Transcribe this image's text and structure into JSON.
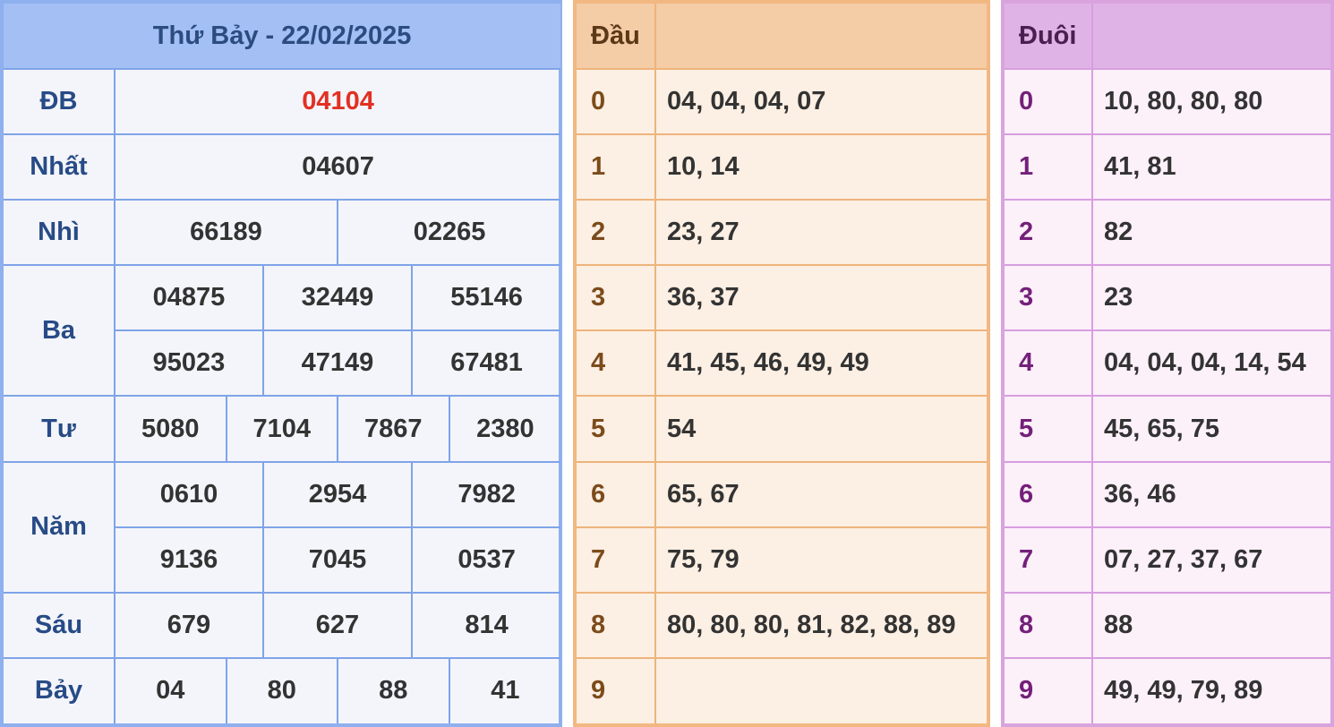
{
  "results": {
    "title": "Thứ Bảy - 22/02/2025",
    "db_label": "ĐB",
    "db": "04104",
    "nhat_label": "Nhất",
    "nhat": "04607",
    "nhi_label": "Nhì",
    "nhi": [
      "66189",
      "02265"
    ],
    "ba_label": "Ba",
    "ba": [
      "04875",
      "32449",
      "55146",
      "95023",
      "47149",
      "67481"
    ],
    "tu_label": "Tư",
    "tu": [
      "5080",
      "7104",
      "7867",
      "2380"
    ],
    "nam_label": "Năm",
    "nam": [
      "0610",
      "2954",
      "7982",
      "9136",
      "7045",
      "0537"
    ],
    "sau_label": "Sáu",
    "sau": [
      "679",
      "627",
      "814"
    ],
    "bay_label": "Bảy",
    "bay": [
      "04",
      "80",
      "88",
      "41"
    ]
  },
  "dau": {
    "header": "Đầu",
    "rows": [
      {
        "digit": "0",
        "values": "04, 04, 04, 07"
      },
      {
        "digit": "1",
        "values": "10, 14"
      },
      {
        "digit": "2",
        "values": "23, 27"
      },
      {
        "digit": "3",
        "values": "36, 37"
      },
      {
        "digit": "4",
        "values": "41, 45, 46, 49, 49"
      },
      {
        "digit": "5",
        "values": "54"
      },
      {
        "digit": "6",
        "values": "65, 67"
      },
      {
        "digit": "7",
        "values": "75, 79"
      },
      {
        "digit": "8",
        "values": "80, 80, 80, 81, 82, 88, 89"
      },
      {
        "digit": "9",
        "values": ""
      }
    ]
  },
  "duoi": {
    "header": "Đuôi",
    "rows": [
      {
        "digit": "0",
        "values": "10, 80, 80, 80"
      },
      {
        "digit": "1",
        "values": "41, 81"
      },
      {
        "digit": "2",
        "values": "82"
      },
      {
        "digit": "3",
        "values": "23"
      },
      {
        "digit": "4",
        "values": "04, 04, 04, 14, 54"
      },
      {
        "digit": "5",
        "values": "45, 65, 75"
      },
      {
        "digit": "6",
        "values": "36, 46"
      },
      {
        "digit": "7",
        "values": "07, 27, 37, 67"
      },
      {
        "digit": "8",
        "values": "88"
      },
      {
        "digit": "9",
        "values": "49, 49, 79, 89"
      }
    ]
  },
  "colors": {
    "special_prize": "#e23023",
    "results_border": "#7fa4e8",
    "dau_border": "#eeb47c",
    "duoi_border": "#d79ee0"
  }
}
